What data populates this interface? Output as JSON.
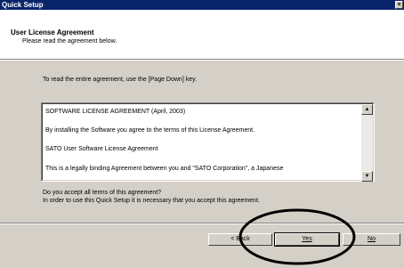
{
  "window": {
    "title": "Quick Setup",
    "close_glyph": "×"
  },
  "header": {
    "title": "User License Agreement",
    "subtitle": "Please read the agreement below."
  },
  "body": {
    "instruction": "To read the entire agreement, use the [Page Down] key.",
    "agreement_lines": [
      "SOFTWARE LICENSE AGREEMENT (April, 2003)",
      "By installing the Software you agree to the terms of this License Agreement.",
      "SATO User Software License Agreement",
      "This is a legally binding Agreement between you and \"SATO Corporation\", a Japanese"
    ],
    "question": "Do you accept all terms of this agreement?",
    "requirement": "In order to use this Quick Setup it is necessary that you accept this agreement."
  },
  "buttons": {
    "back": "< Back",
    "yes": "Yes",
    "no": "No"
  },
  "icons": {
    "close": "close-icon",
    "scroll_up": "scroll-up-arrow-icon",
    "scroll_down": "scroll-down-arrow-icon"
  }
}
